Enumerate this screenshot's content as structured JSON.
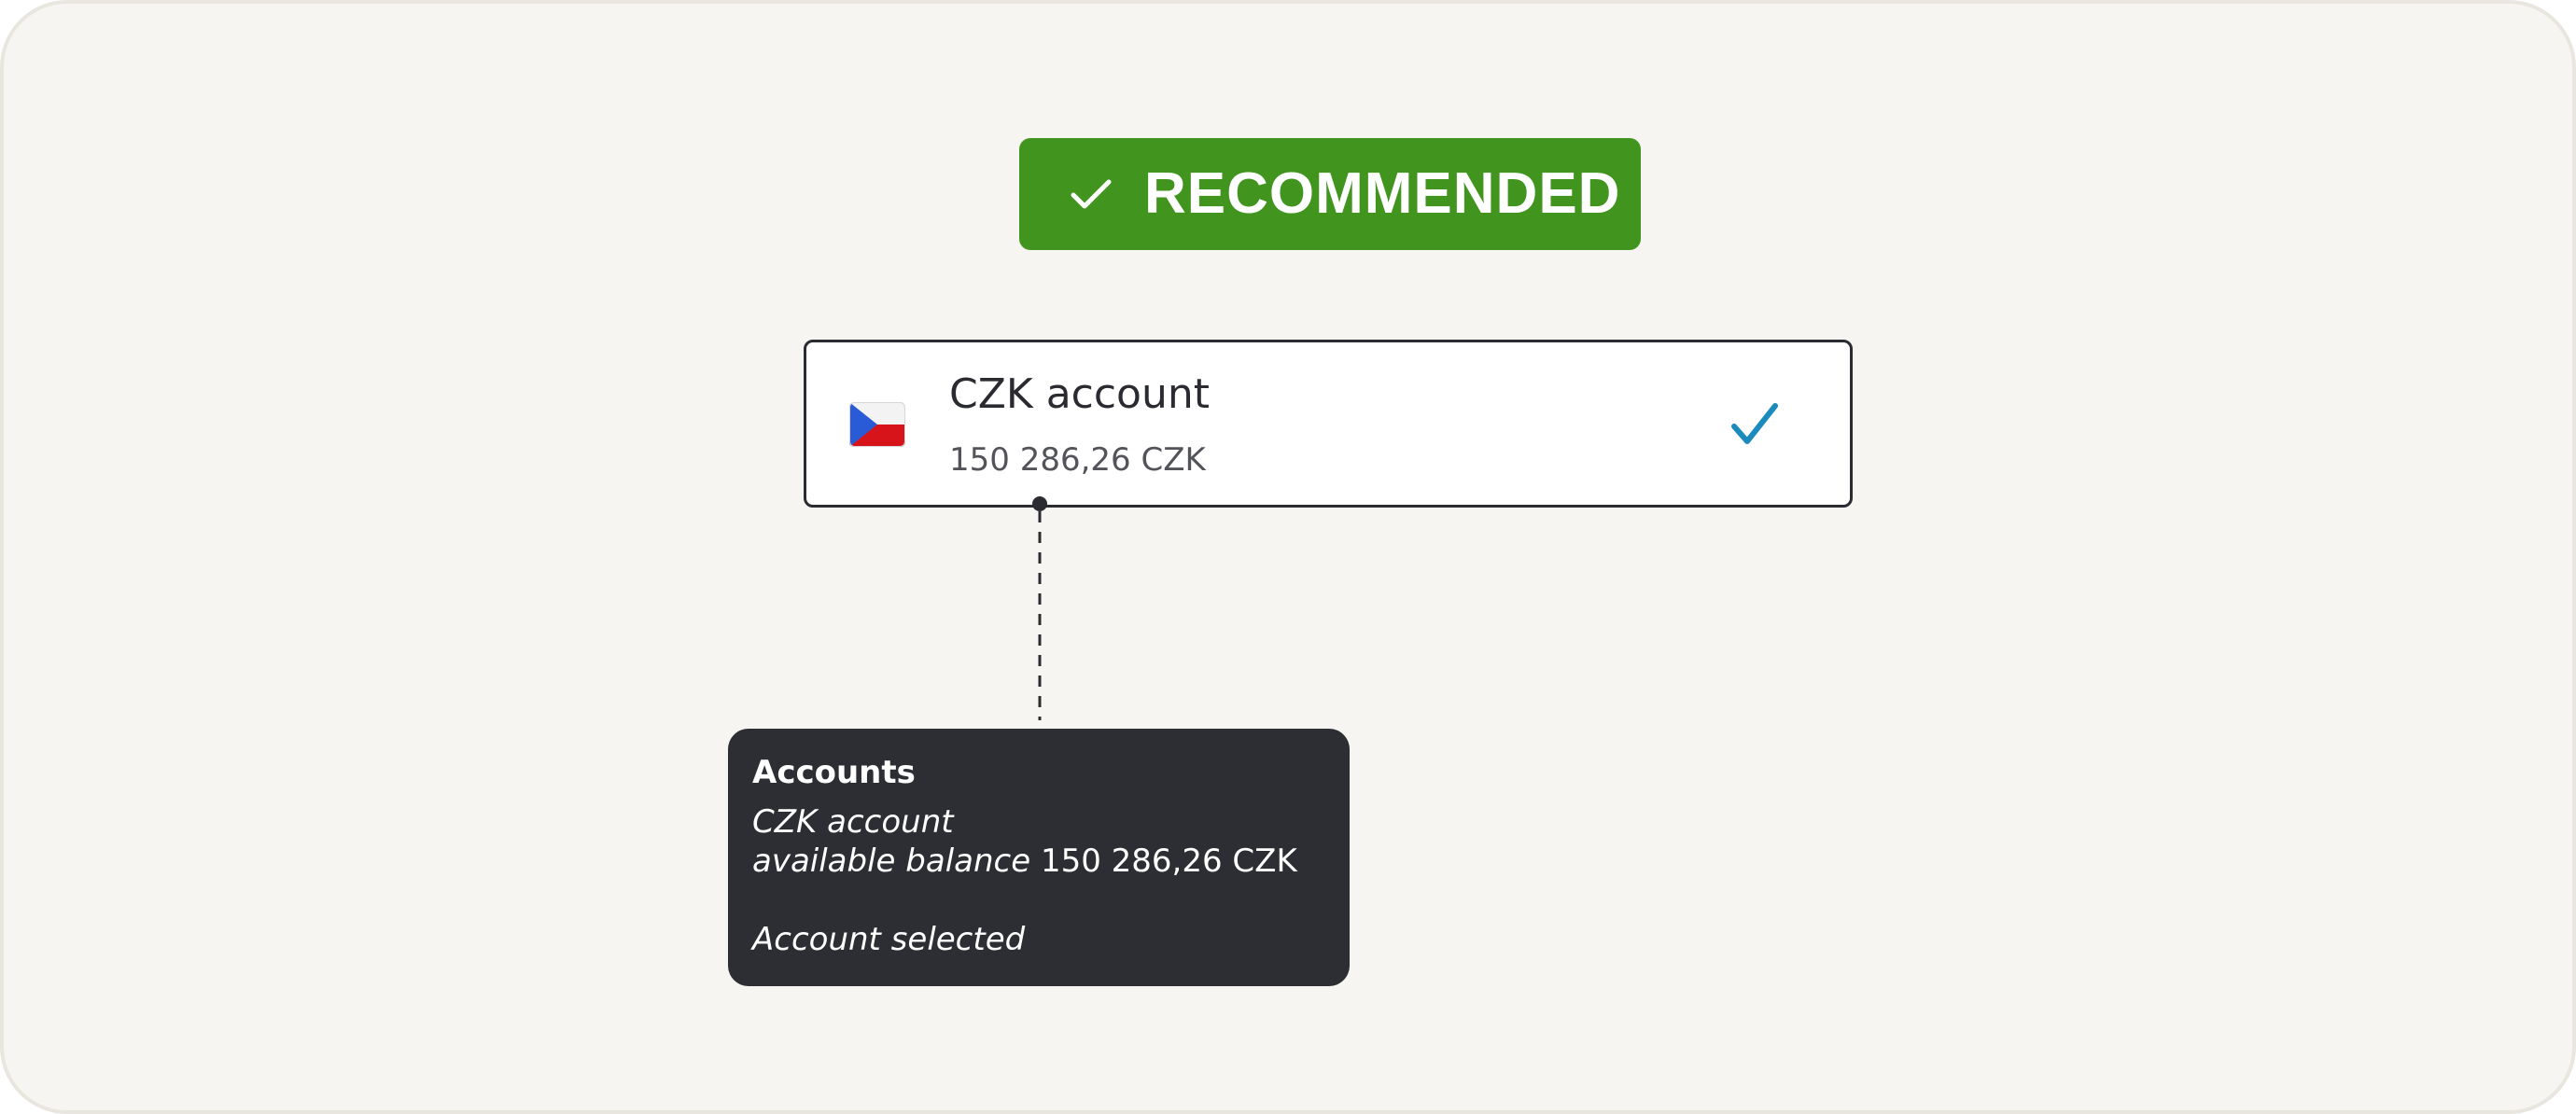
{
  "badge": {
    "label": "RECOMMENDED",
    "icon": "check-icon",
    "color": "#41951f"
  },
  "account": {
    "flag_icon": "czech-flag-icon",
    "name": "CZK account",
    "balance": "150 286,26 CZK",
    "selected_icon": "checkmark-icon",
    "check_color": "#1b8bbd",
    "selected": true
  },
  "tooltip": {
    "title": "Accounts",
    "line1": "CZK account",
    "line2_prefix": "available balance",
    "line2_value": "150 286,26 CZK",
    "status": "Account selected"
  }
}
